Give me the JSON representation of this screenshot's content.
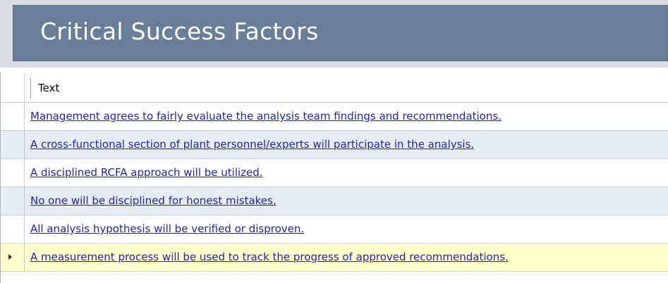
{
  "panel": {
    "title": "Critical Success Factors"
  },
  "grid": {
    "column_header": "Text",
    "rows": [
      {
        "text": "Management agrees to fairly evaluate the analysis team findings and recommendations."
      },
      {
        "text": "A cross-functional section of plant personnel/experts will participate in the analysis."
      },
      {
        "text": "A disciplined RCFA approach will be utilized."
      },
      {
        "text": "No one will be disciplined for honest mistakes."
      },
      {
        "text": "All analysis hypothesis will be verified or disproven."
      },
      {
        "text": "A measurement process will be used to track the progress of approved recommendations."
      }
    ],
    "current_row_index": 5,
    "current_row_icon": "row-pointer-icon"
  },
  "colors": {
    "header_background": "#697f98",
    "link": "#1f1fbf",
    "alternate_row": "#e7edf5",
    "current_row": "#ffffcc"
  }
}
